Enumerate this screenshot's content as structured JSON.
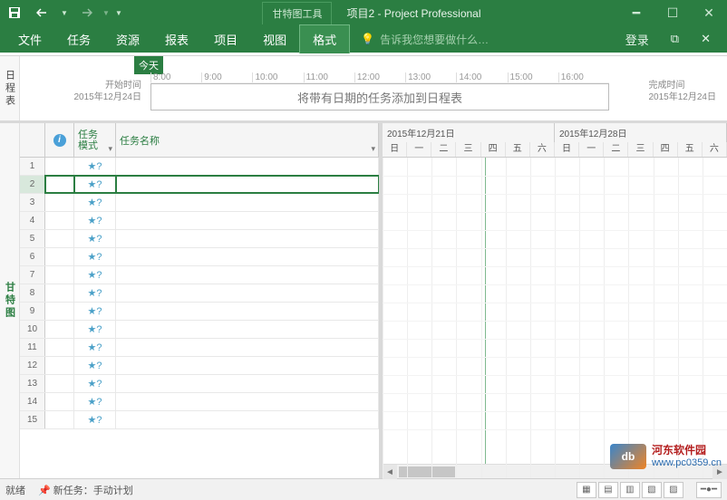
{
  "titlebar": {
    "tool_tab": "甘特图工具",
    "title": "项目2 - Project Professional"
  },
  "ribbon": {
    "tabs": [
      "文件",
      "任务",
      "资源",
      "报表",
      "项目",
      "视图",
      "格式"
    ],
    "active_index": 6,
    "tell_me": "告诉我您想要做什么…",
    "login": "登录"
  },
  "timeline": {
    "pane_label": "日程表",
    "today": "今天",
    "hours": [
      "8:00",
      "9:00",
      "10:00",
      "11:00",
      "12:00",
      "13:00",
      "14:00",
      "15:00",
      "16:00"
    ],
    "start_label": "开始时间",
    "start_date": "2015年12月24日",
    "end_label": "完成时间",
    "end_date": "2015年12月24日",
    "placeholder": "将带有日期的任务添加到日程表"
  },
  "sheet": {
    "pane_label": "甘特图",
    "columns": {
      "info_icon": "ℹ",
      "mode_l1": "任务",
      "mode_l2": "模式",
      "name": "任务名称"
    },
    "row_numbers": [
      "1",
      "2",
      "3",
      "4",
      "5",
      "6",
      "7",
      "8",
      "9",
      "10",
      "11",
      "12",
      "13",
      "14",
      "15"
    ],
    "mode_icon": "★?",
    "selected_row": 2
  },
  "gantt": {
    "weeks": [
      "2015年12月21日",
      "2015年12月28日"
    ],
    "days": [
      "日",
      "一",
      "二",
      "三",
      "四",
      "五",
      "六",
      "日",
      "一",
      "二",
      "三",
      "四",
      "五",
      "六"
    ]
  },
  "status": {
    "ready": "就绪",
    "new_task": "新任务：手动计划"
  },
  "watermark": {
    "name": "河东软件园",
    "url": "www.pc0359.cn"
  }
}
